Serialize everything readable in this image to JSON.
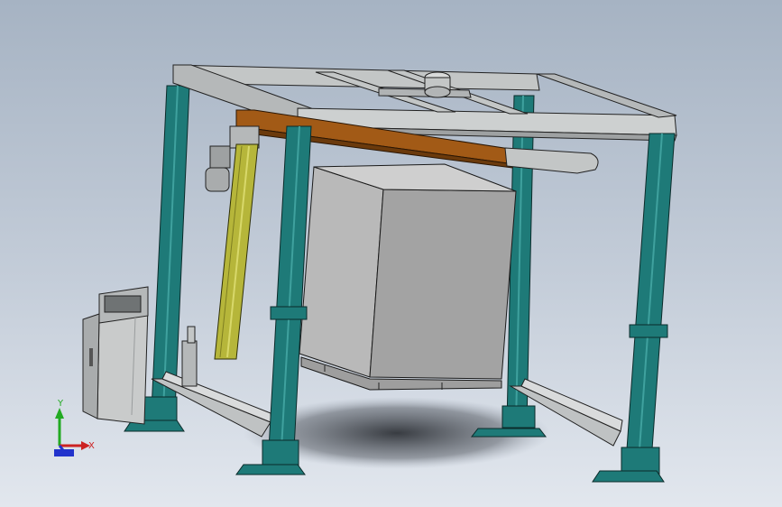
{
  "viewport": {
    "background_top": "#a6b3c3",
    "background_bottom": "#e2e7ee"
  },
  "model": {
    "frame_color": "#c3c6c6",
    "column_color": "#1e7a78",
    "arm_color": "#a25a16",
    "mast_color": "#b6b63a",
    "load_color": "#b9b9b9",
    "cabinet_color": "#c9cbcb"
  },
  "triad": {
    "x_label": "X",
    "y_label": "Y",
    "x_color": "#cc2222",
    "y_color": "#22aa22",
    "z_color": "#2233cc"
  }
}
